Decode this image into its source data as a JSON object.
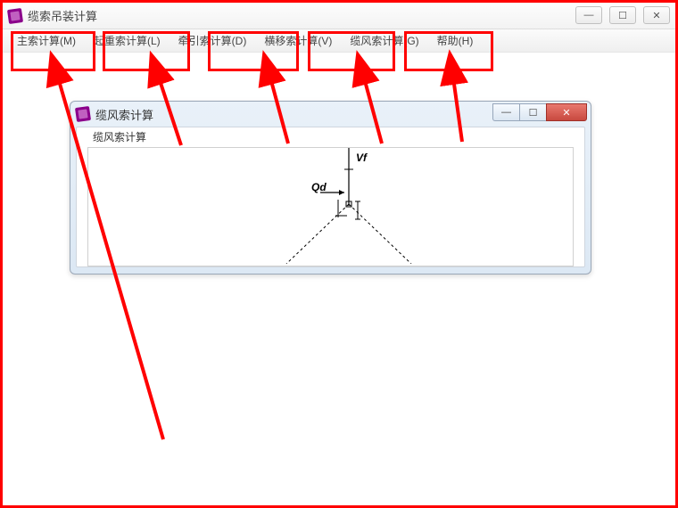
{
  "main_window": {
    "title": "缆索吊装计算"
  },
  "menu": {
    "items": [
      {
        "label": "主索计算(M)"
      },
      {
        "label": "起重索计算(L)"
      },
      {
        "label": "牵引索计算(D)"
      },
      {
        "label": "横移索计算(V)"
      },
      {
        "label": "缆风索计算(G)"
      },
      {
        "label": "帮助(H)"
      }
    ]
  },
  "child_window": {
    "title": "缆风索计算",
    "groupbox_label": "缆风索计算",
    "diagram_labels": {
      "top": "Vf",
      "left": "Qd"
    }
  },
  "window_button_glyphs": {
    "minimize": "—",
    "maximize": "☐",
    "close": "✕"
  }
}
